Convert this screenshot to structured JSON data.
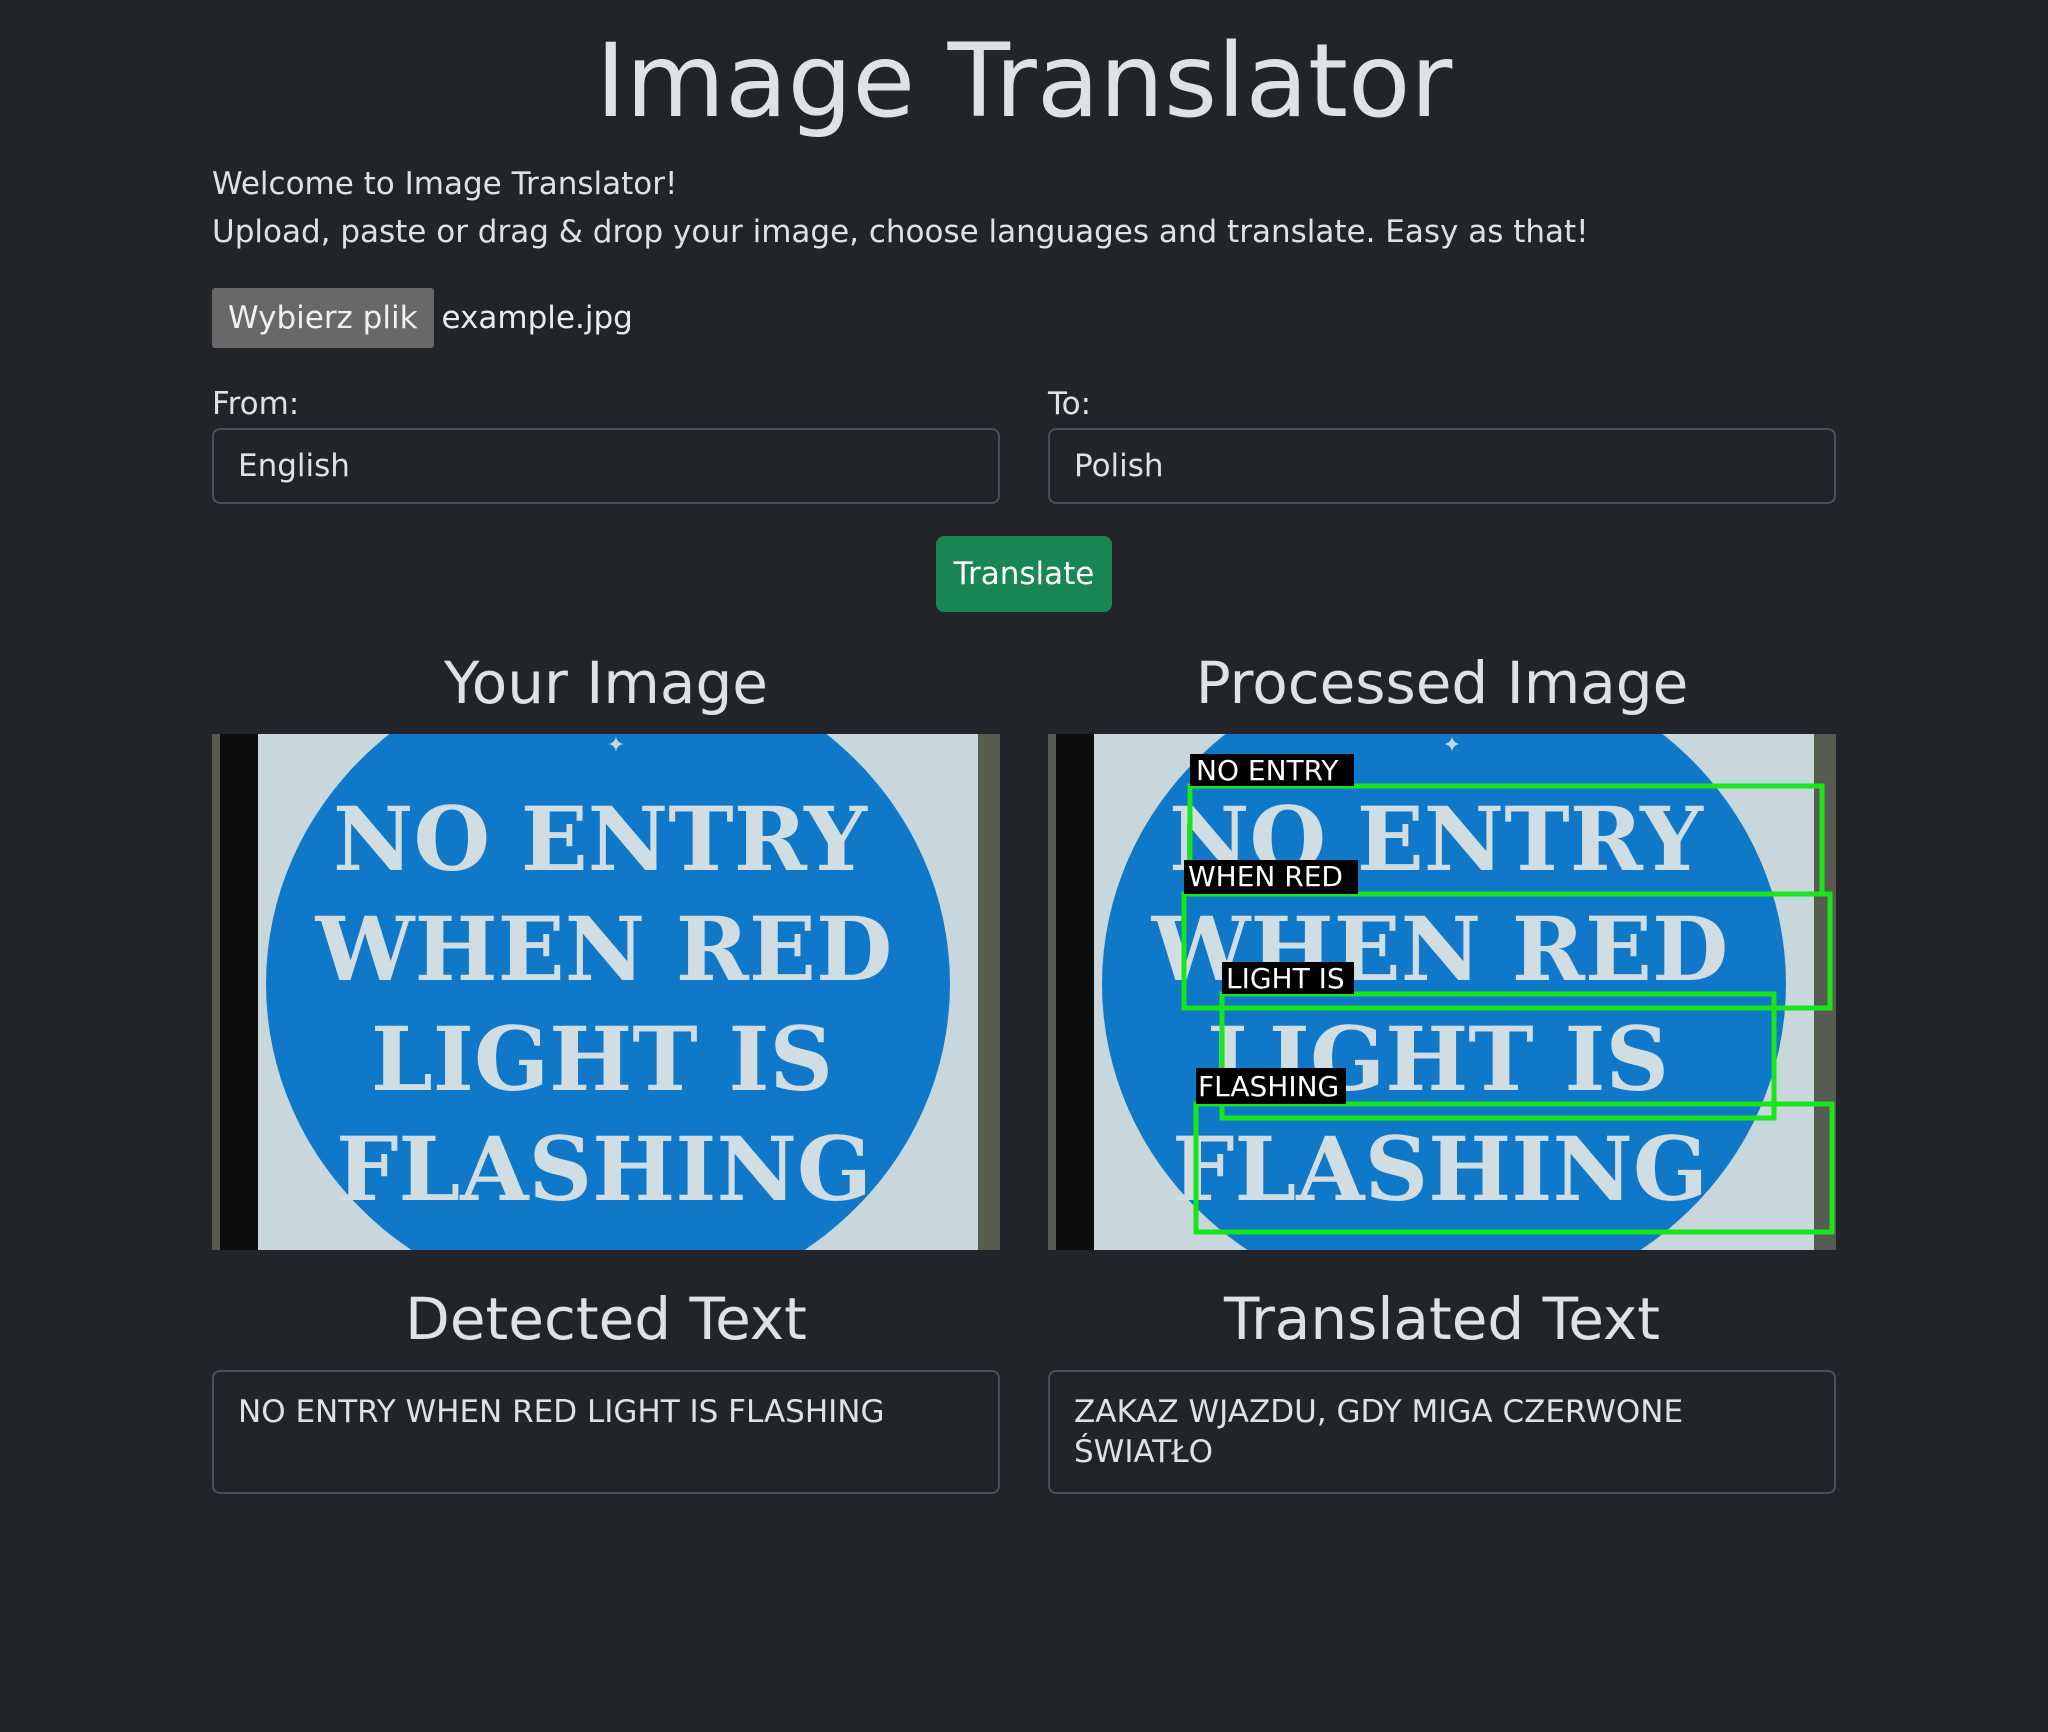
{
  "page": {
    "title": "Image Translator",
    "intro_line1": "Welcome to Image Translator!",
    "intro_line2": "Upload, paste or drag & drop your image, choose languages and translate. Easy as that!"
  },
  "file_input": {
    "button_label": "Wybierz plik",
    "file_name": "example.jpg"
  },
  "languages": {
    "from_label": "From:",
    "from_value": "English",
    "to_label": "To:",
    "to_value": "Polish"
  },
  "translate_button": "Translate",
  "your_image": {
    "title": "Your Image",
    "sign_lines": [
      "NO ENTRY",
      "WHEN RED",
      "LIGHT IS",
      "FLASHING"
    ]
  },
  "processed_image": {
    "title": "Processed Image",
    "sign_lines": [
      "NO ENTRY",
      "WHEN RED",
      "LIGHT IS",
      "FLASHING"
    ],
    "detection_labels": [
      "NO ENTRY",
      "WHEN RED",
      "LIGHT IS",
      "FLASHING"
    ],
    "box_color": "#19e619"
  },
  "detected_text": {
    "title": "Detected Text",
    "value": "NO ENTRY WHEN RED LIGHT IS FLASHING"
  },
  "translated_text": {
    "title": "Translated Text",
    "value": "ZAKAZ WJAZDU, GDY MIGA CZERWONE ŚWIATŁO"
  },
  "colors": {
    "background": "#212529",
    "translate_button": "#198754",
    "sign_blue": "#0f78c8",
    "sign_white": "#c8d7dc"
  }
}
